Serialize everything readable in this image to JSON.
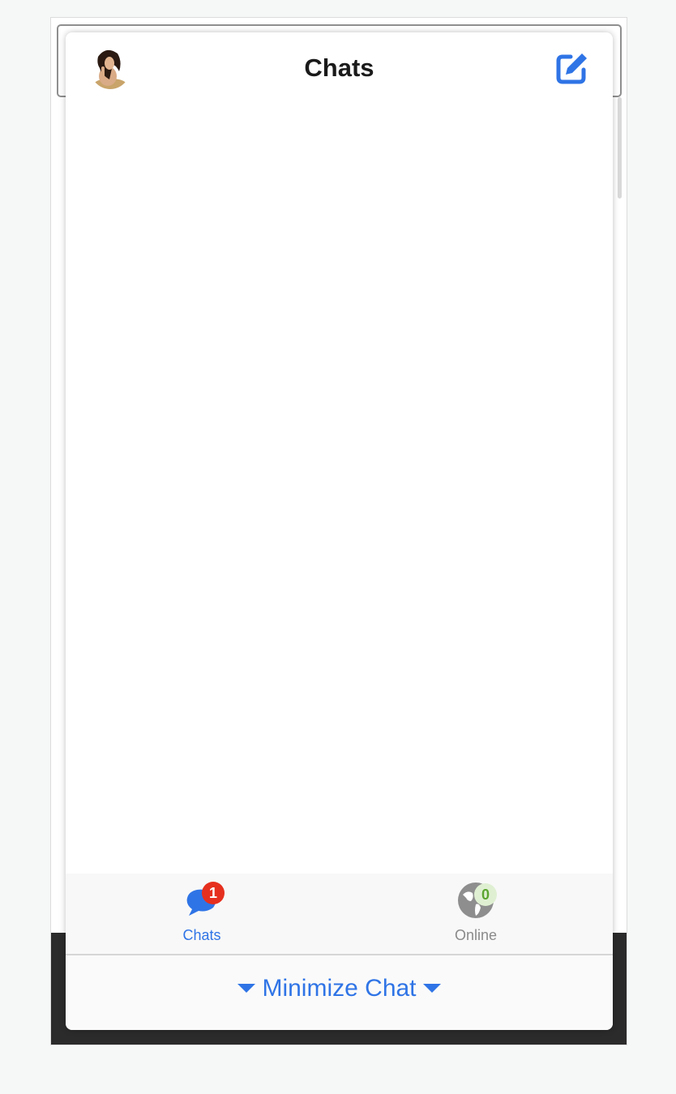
{
  "header": {
    "title": "Chats"
  },
  "tabs": [
    {
      "label": "Chats",
      "badge": "1",
      "icon": "chat-bubbles-icon",
      "active": true
    },
    {
      "label": "Online",
      "badge": "0",
      "icon": "globe-icon",
      "active": false
    }
  ],
  "minimize": {
    "label": "Minimize Chat"
  },
  "colors": {
    "accent": "#2f74e6",
    "badge_red": "#e6301f",
    "badge_green": "#5aa52f",
    "inactive_gray": "#8a8a8a"
  }
}
